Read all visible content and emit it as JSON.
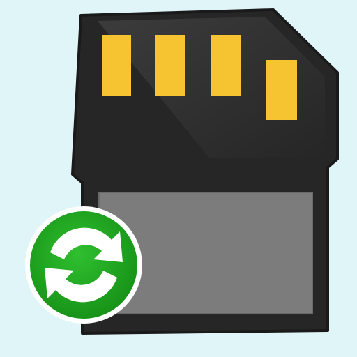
{
  "icon": {
    "name": "sd-card-sync-icon",
    "card": {
      "name": "sd-card-icon",
      "body_color": "#262626",
      "contact_color": "#f5c430",
      "contact_count": 4,
      "label_color": "#7c7c7c"
    },
    "badge": {
      "name": "sync-icon",
      "fill_color": "#1fa51f",
      "ring_color": "#ffffff",
      "arrow_color": "#ffffff"
    },
    "background_color": "#dff5f8"
  }
}
